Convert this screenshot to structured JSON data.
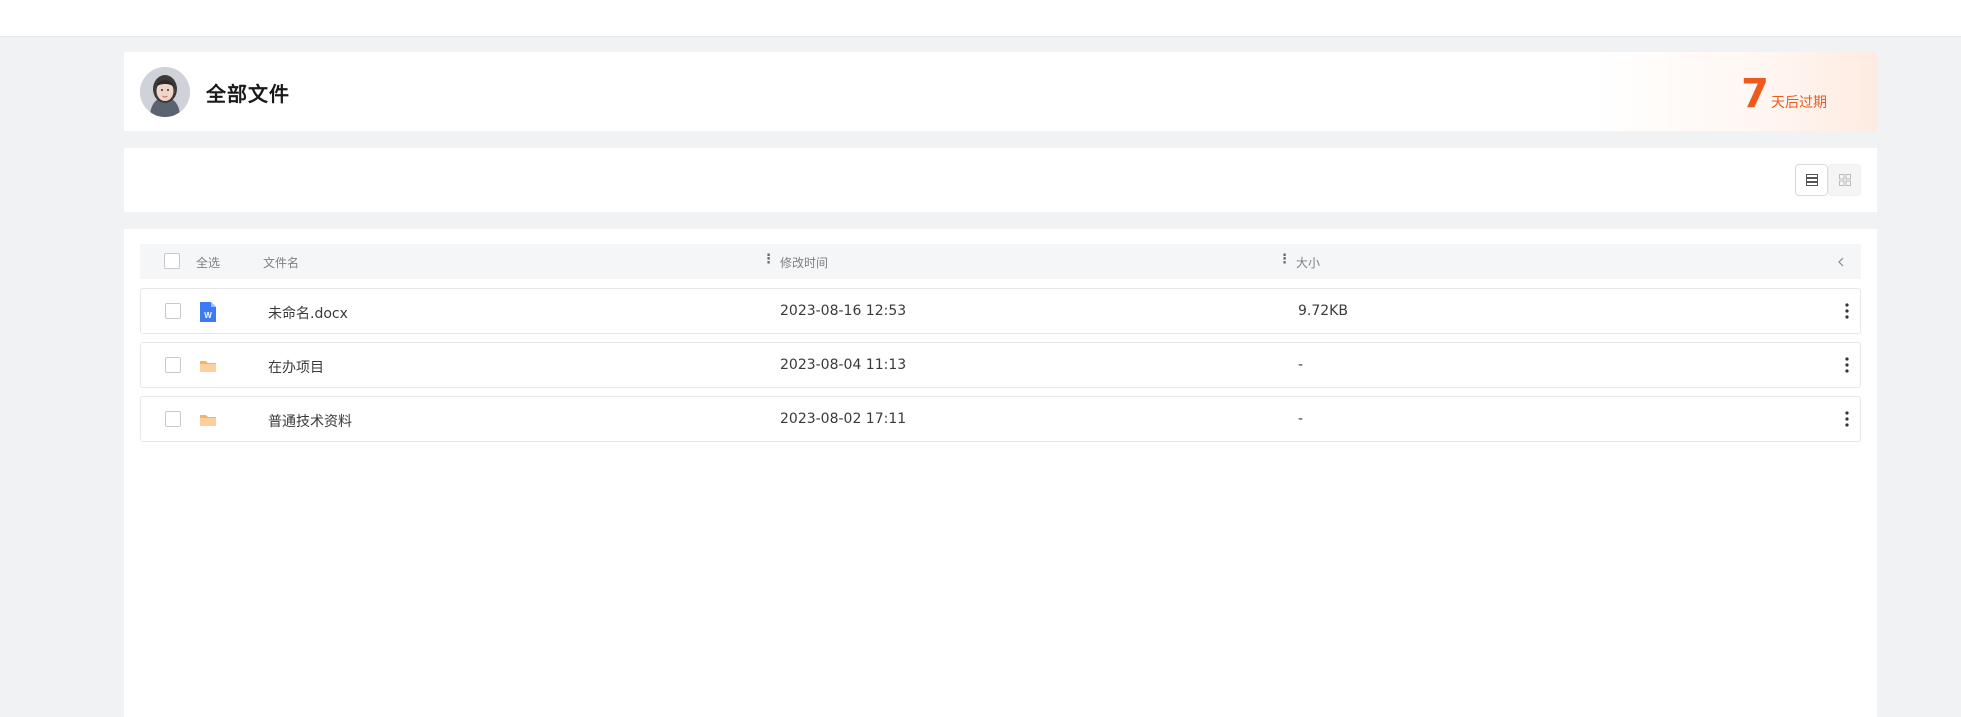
{
  "header": {
    "title": "全部文件",
    "expire_number": "7",
    "expire_text": "天后过期"
  },
  "toolbar": {
    "view_modes": [
      "list-view-icon",
      "grid-view-icon"
    ],
    "active_view": "list"
  },
  "table": {
    "headers": {
      "select_all": "全选",
      "name": "文件名",
      "modified": "修改时间",
      "size": "大小"
    },
    "rows": [
      {
        "icon": "word-doc-icon",
        "name": "未命名.docx",
        "modified": "2023-08-16 12:53",
        "size": "9.72KB"
      },
      {
        "icon": "folder-icon",
        "name": "在办项目",
        "modified": "2023-08-04 11:13",
        "size": "-"
      },
      {
        "icon": "folder-icon",
        "name": "普通技术资料",
        "modified": "2023-08-02 17:11",
        "size": "-"
      }
    ]
  },
  "colors": {
    "accent_orange": "#ec5a1d",
    "word_blue": "#3b7cf6",
    "folder_orange": "#f7b26a"
  }
}
